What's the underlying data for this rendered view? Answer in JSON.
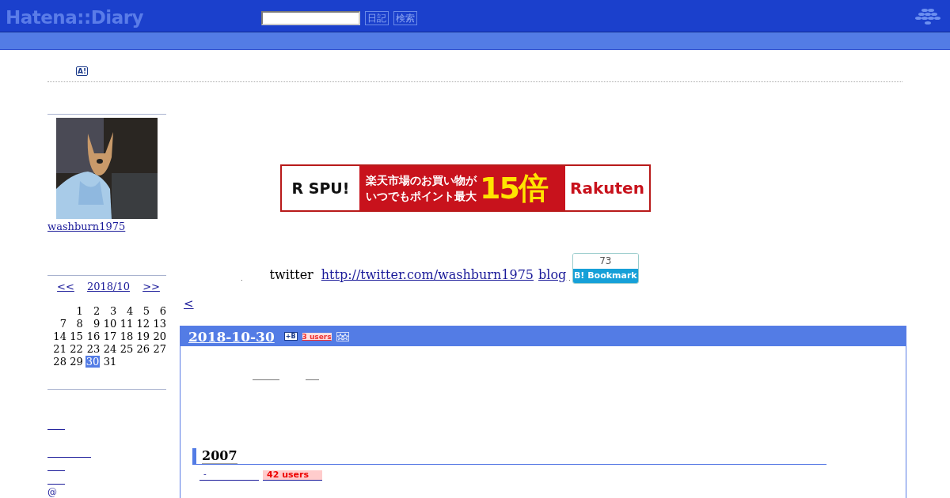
{
  "header": {
    "logo": "Hatena::Diary",
    "buttons": [
      "日記",
      "検索"
    ]
  },
  "antenna_badge": "A!",
  "profile": {
    "kind": "picture",
    "username": "washburn1975"
  },
  "calendar": {
    "prev": "<<",
    "month": "2018/10",
    "next": ">>",
    "weeks": [
      [
        {
          "day": "1",
          "selected": false
        },
        {
          "day": "2",
          "selected": false
        },
        {
          "day": "3",
          "selected": false
        },
        {
          "day": "4",
          "selected": false
        },
        {
          "day": "5",
          "selected": false
        },
        {
          "day": "6",
          "selected": false
        }
      ],
      [
        {
          "day": "7",
          "selected": false
        },
        {
          "day": "8",
          "selected": false
        },
        {
          "day": "9",
          "selected": false
        },
        {
          "day": "10",
          "selected": false
        },
        {
          "day": "11",
          "selected": false
        },
        {
          "day": "12",
          "selected": false
        },
        {
          "day": "13",
          "selected": false
        }
      ],
      [
        {
          "day": "14",
          "selected": false
        },
        {
          "day": "15",
          "selected": false
        },
        {
          "day": "16",
          "selected": false
        },
        {
          "day": "17",
          "selected": false
        },
        {
          "day": "18",
          "selected": false
        },
        {
          "day": "19",
          "selected": false
        },
        {
          "day": "20",
          "selected": false
        }
      ],
      [
        {
          "day": "21",
          "selected": false
        },
        {
          "day": "22",
          "selected": false
        },
        {
          "day": "23",
          "selected": false
        },
        {
          "day": "24",
          "selected": false
        },
        {
          "day": "25",
          "selected": false
        },
        {
          "day": "26",
          "selected": false
        },
        {
          "day": "27",
          "selected": false
        }
      ],
      [
        {
          "day": "28",
          "selected": false
        },
        {
          "day": "29",
          "selected": false
        },
        {
          "day": "30",
          "selected": true
        },
        {
          "day": "31",
          "selected": false
        }
      ]
    ]
  },
  "sidebar_footer": "@",
  "banner": {
    "left": "R SPU!",
    "line_1": "楽天市場のお買い物が",
    "line_2": "いつでもポイント最大",
    "big": "15倍",
    "right": "Rakuten"
  },
  "intro": {
    "dot_1": ".",
    "label": "twitter",
    "link": "http://twitter.com/washburn1975",
    "blog_link": "blog",
    "dot_2": ".",
    "bookmark_count": "73",
    "bookmark_logo": "B!",
    "bookmark_label": "Bookmark"
  },
  "prev_link": "<",
  "day": {
    "date": "2018-10-30",
    "add_bookmark": "+B",
    "users": "3 users",
    "section": {
      "title": "2007",
      "entry_link": "-",
      "entry_users": "42 users"
    }
  }
}
